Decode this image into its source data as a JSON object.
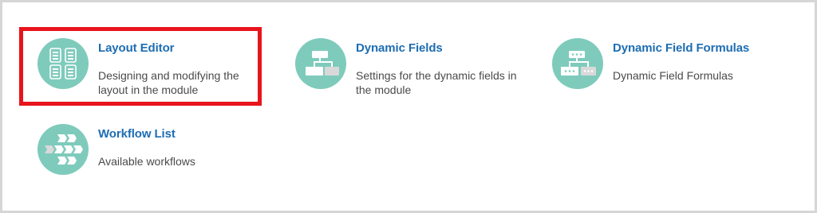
{
  "items": [
    {
      "title": "Layout Editor",
      "description": "Designing and modifying the layout in the module",
      "icon": "layout-editor-icon"
    },
    {
      "title": "Dynamic Fields",
      "description": "Settings for the dynamic fields in the module",
      "icon": "dynamic-fields-icon"
    },
    {
      "title": "Dynamic Field Formulas",
      "description": "Dynamic Field Formulas",
      "icon": "dynamic-field-formulas-icon"
    },
    {
      "title": "Workflow List",
      "description": "Available workflows",
      "icon": "workflow-list-icon"
    }
  ],
  "colors": {
    "title": "#1d6db3",
    "description": "#4a4a4a",
    "icon_background": "#7ecbbc",
    "highlight_border": "#e8141c",
    "frame_border": "#d6d6d6"
  }
}
